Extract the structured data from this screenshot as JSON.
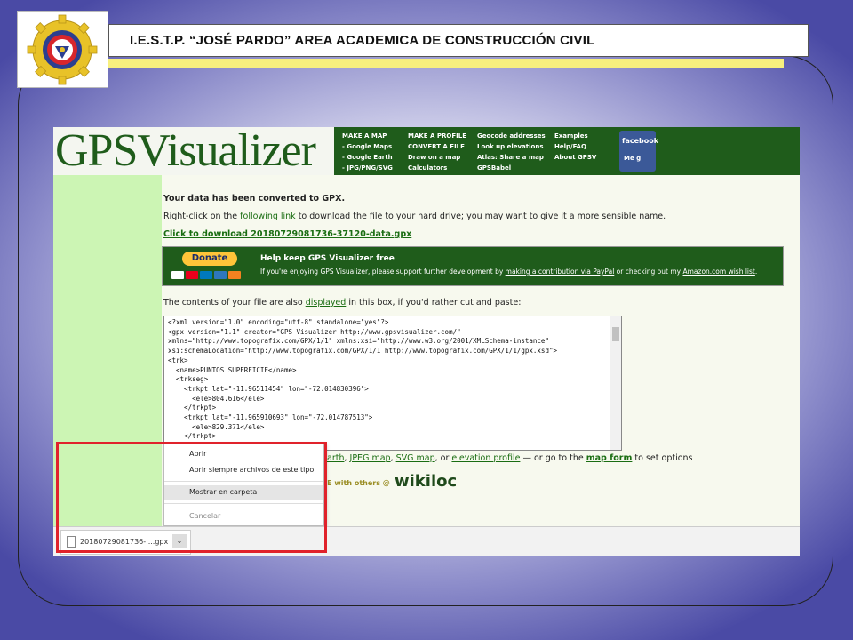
{
  "header": {
    "title": "I.E.S.T.P. “JOSÉ PARDO” AREA ACADEMICA DE CONSTRUCCIÓN CIVIL"
  },
  "gps": {
    "logo": "GPSVisualizer",
    "nav_col1": [
      "MAKE A MAP",
      "- Google Maps",
      "- Google Earth",
      "- JPG/PNG/SVG"
    ],
    "nav_col2": [
      "MAKE A PROFILE",
      "CONVERT A FILE",
      "Draw on a map",
      "Calculators"
    ],
    "nav_col3": [
      "Geocode addresses",
      "Look up elevations",
      "Atlas: Share a map",
      "GPSBabel"
    ],
    "nav_col4": [
      "Examples",
      "Help/FAQ",
      "About GPSV"
    ],
    "facebook_label": "facebook",
    "facebook_like": "Me g",
    "converted_msg": "Your data has been converted to GPX.",
    "rightclick_pre": "Right-click on the ",
    "rightclick_link": "following link",
    "rightclick_post": " to download the file to your hard drive; you may want to give it a more sensible name.",
    "download_link": "Click to download 20180729081736-37120-data.gpx",
    "donate": {
      "button": "Donate",
      "title": "Help keep GPS Visualizer free",
      "text_pre": "If you're enjoying GPS Visualizer, please support further development by ",
      "link1": "making a contribution via PayPal",
      "text_mid": " or checking out my ",
      "link2": "Amazon.com wish list",
      "text_end": "."
    },
    "contents_pre": "The contents of your file are also ",
    "contents_link": "displayed",
    "contents_post": " in this box, if you'd rather cut and paste:",
    "xml_content": "<?xml version=\"1.0\" encoding=\"utf-8\" standalone=\"yes\"?>\n<gpx version=\"1.1\" creator=\"GPS Visualizer http://www.gpsvisualizer.com/\"\nxmlns=\"http://www.topografix.com/GPX/1/1\" xmlns:xsi=\"http://www.w3.org/2001/XMLSchema-instance\"\nxsi:schemaLocation=\"http://www.topografix.com/GPX/1/1 http://www.topografix.com/GPX/1/1/gpx.xsd\">\n<trk>\n  <name>PUNTOS SUPERFICIE</name>\n  <trkseg>\n    <trkpt lat=\"-11.96511454\" lon=\"-72.014830396\">\n      <ele>804.616</ele>\n    </trkpt>\n    <trkpt lat=\"-11.965910693\" lon=\"-72.014787513\">\n      <ele>829.371</ele>\n    </trkpt>",
    "below_links": {
      "earth": "Earth",
      "sep1": ", ",
      "jpeg": "JPEG map",
      "sep2": ", ",
      "svg": "SVG map",
      "sep3": ", or ",
      "elev": "elevation profile",
      "mid": " — or go to the ",
      "mapform": "map form",
      "end": " to set options"
    },
    "wikiloc_share": "RE with others @",
    "wikiloc_logo": "wikiloc"
  },
  "context_menu": {
    "items": [
      "Abrir",
      "Abrir siempre archivos de este tipo",
      "Mostrar en carpeta",
      "Cancelar"
    ]
  },
  "download_bar": {
    "filename": "20180729081736-....gpx",
    "chevron": "⌄"
  },
  "colors": {
    "gps_green": "#1f5c1b",
    "sidebar_green": "#ccf5b4",
    "highlight_red": "#e0222b",
    "header_yellow": "#f7ef7e"
  }
}
